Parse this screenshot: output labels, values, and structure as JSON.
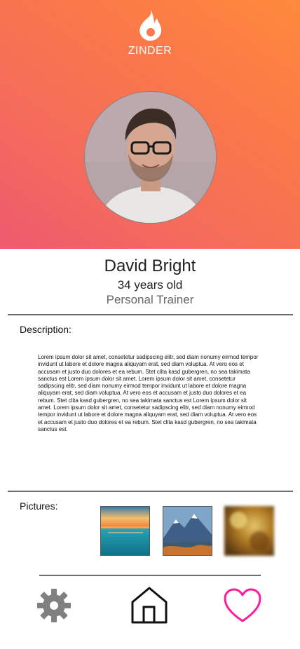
{
  "app": {
    "logo_text": "ZINDER",
    "brand_color": "#ff7e45",
    "accent_pink": "#ff1aa0"
  },
  "profile": {
    "name": "David Bright",
    "age": "34 years old",
    "occupation": "Personal Trainer",
    "avatar_icon": "profile-photo"
  },
  "description": {
    "title": "Description:",
    "body": "Lorem ipsum dolor sit amet, consetetur sadipscing elitr, sed diam nonumy eirmod tempor invidunt ut labore et dolore magna aliquyam erat, sed diam voluptua. At vero eos et accusam et justo duo dolores et ea rebum. Stet clita kasd gubergren, no sea takimata sanctus est Lorem ipsum dolor sit amet. Lorem ipsum dolor sit amet, consetetur sadipscing elitr, sed diam nonumy eirmod tempor invidunt ut labore et dolore magna aliquyam erat, sed diam voluptua. At vero eos et accusam et justo duo dolores et ea rebum. Stet clita kasd gubergren, no sea takimata sanctus est Lorem ipsum dolor sit amet. Lorem ipsum dolor sit amet, consetetur sadipscing elitr, sed diam nonumy eirmod tempor invidunt ut labore et dolore magna aliquyam erat, sed diam voluptua. At vero eos et accusam et justo duo dolores et ea rebum. Stet clita kasd gubergren, no sea takimata sanctus est."
  },
  "pictures": {
    "title": "Pictures:",
    "items": [
      "sunset-sea-photo",
      "mountain-lake-photo",
      "blurred-photo"
    ]
  },
  "nav": {
    "settings_icon": "gear-icon",
    "home_icon": "home-icon",
    "like_icon": "heart-icon"
  }
}
